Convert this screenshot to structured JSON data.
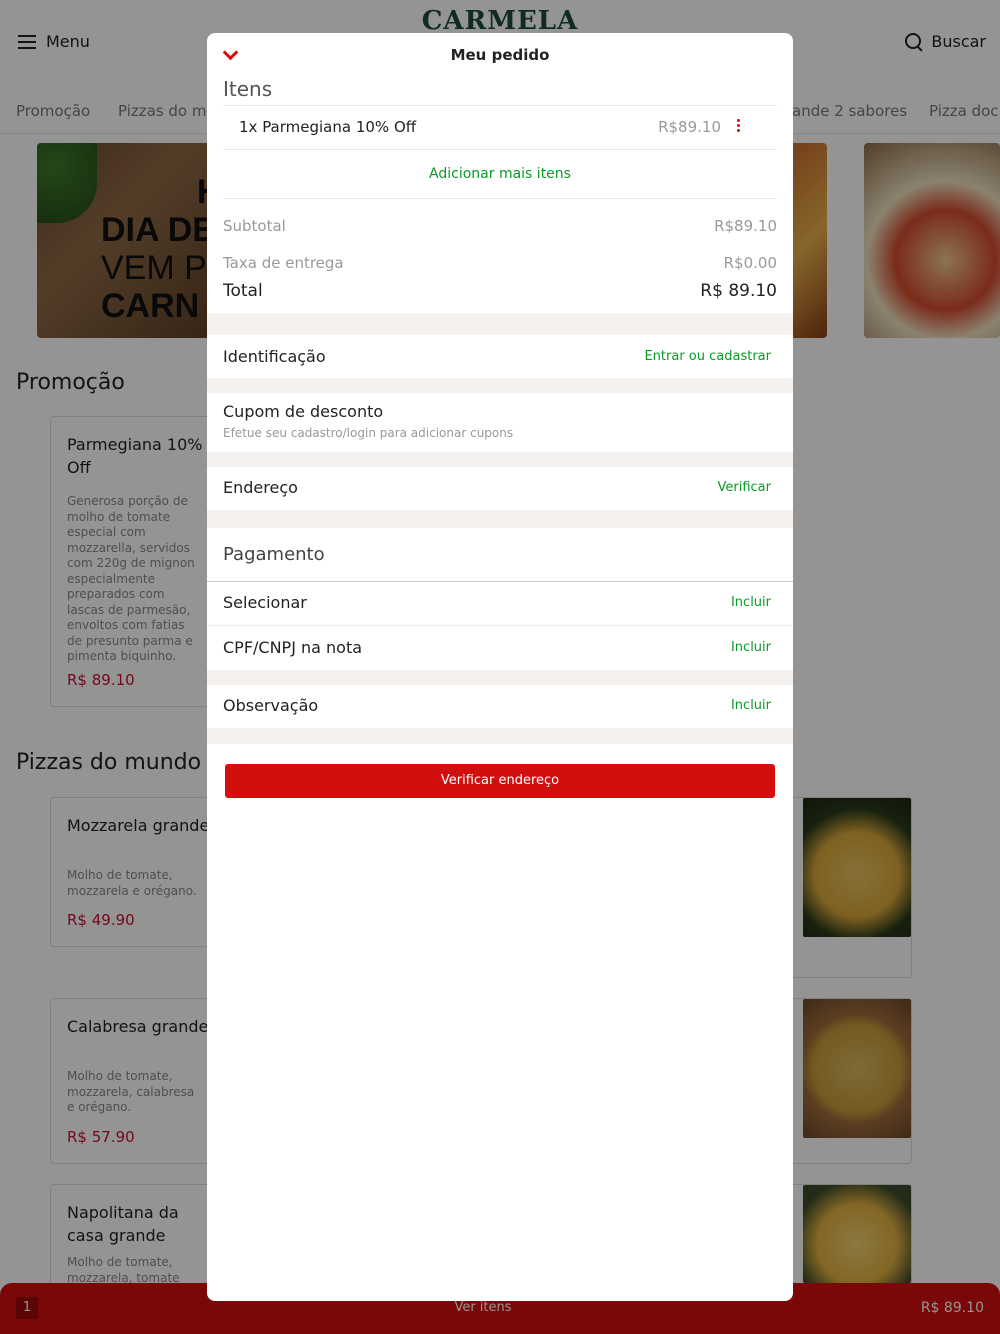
{
  "header": {
    "menu_label": "Menu",
    "logo_text": "CARMELA",
    "search_label": "Buscar"
  },
  "categories": [
    "Promoção",
    "Pizzas do mu",
    "ande 2 sabores",
    "Pizza doc"
  ],
  "banner": {
    "line1": "H",
    "line2": "DIA DE",
    "line3": "VEM P",
    "line4": "CARN"
  },
  "sections": {
    "promo_title": "Promoção",
    "world_title": "Pizzas do mundo -"
  },
  "products": [
    {
      "name": "Parmegiana 10% Off",
      "desc": "Generosa porção de molho de tomate especial com mozzarella, servidos com 220g de mignon especialmente preparados com lascas de parmesão, envoltos com fatias de presunto parma e pimenta biquinho.",
      "price": "R$ 89.10"
    },
    {
      "name": "Mozzarela grande",
      "desc": "Molho de tomate, mozzarela e orégano.",
      "price": "R$ 49.90"
    },
    {
      "name": "Calabresa grande",
      "desc": "Molho de tomate, mozzarela, calabresa e orégano.",
      "price": "R$ 57.90"
    },
    {
      "name": "Napolitana da casa grande",
      "desc": "Molho de tomate, mozzarela, tomate",
      "price": ""
    }
  ],
  "cart_bar": {
    "count": "1",
    "view_label": "Ver itens",
    "total": "R$ 89.10"
  },
  "order": {
    "title": "Meu pedido",
    "items_title": "Itens",
    "items": [
      {
        "name": "1x Parmegiana 10% Off",
        "price": "R$89.10"
      }
    ],
    "add_more": "Adicionar mais itens",
    "subtotal_label": "Subtotal",
    "subtotal_value": "R$89.10",
    "delivery_label": "Taxa de entrega",
    "delivery_value": "R$0.00",
    "total_label": "Total",
    "total_value": "R$ 89.10",
    "identification_label": "Identificação",
    "identification_link": "Entrar ou cadastrar",
    "coupon_label": "Cupom de desconto",
    "coupon_sub": "Efetue seu cadastro/login para adicionar cupons",
    "address_label": "Endereço",
    "address_link": "Verificar",
    "payment_title": "Pagamento",
    "select_label": "Selecionar",
    "select_link": "Incluir",
    "cpf_label": "CPF/CNPJ na nota",
    "cpf_link": "Incluir",
    "obs_label": "Observação",
    "obs_link": "Incluir",
    "cta_label": "Verificar endereço"
  },
  "colors": {
    "accent_red": "#d20f0f",
    "link_green": "#0a9a28",
    "price_red": "#c8102e",
    "logo_green": "#1d4a36"
  }
}
